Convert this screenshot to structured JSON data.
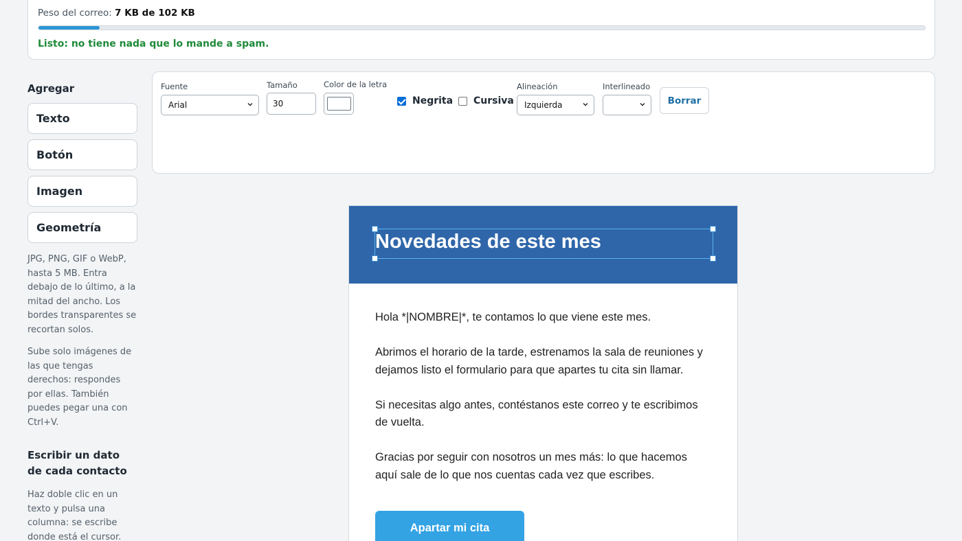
{
  "weight": {
    "label": "Peso del correo:",
    "value": "7 KB de 102 KB",
    "used_kb": 7,
    "total_kb": 102,
    "status": "Listo: no tiene nada que lo mande a spam.",
    "status_color": "#1f8a3a",
    "bar_color": "#2b95d6"
  },
  "sidebar": {
    "heading": "Agregar",
    "buttons": [
      "Texto",
      "Botón",
      "Imagen",
      "Geometría"
    ],
    "note_image": "JPG, PNG, GIF o WebP, hasta 5 MB. Entra debajo de lo último, a la mitad del ancho. Los bordes transparentes se recortan solos.",
    "note_rights": "Sube solo imágenes de las que tengas derechos: respondes por ellas. También puedes pegar una con Ctrl+V.",
    "heading_contact": "Escribir un dato de cada contacto",
    "note_contact": "Haz doble clic en un texto y pulsa una columna: se escribe donde está el cursor."
  },
  "toolbar": {
    "font_label": "Fuente",
    "font_value": "Arial",
    "size_label": "Tamaño",
    "size_value": "30",
    "color_label": "Color de la letra",
    "color_value": "#ffffff",
    "bold_label": "Negrita",
    "bold_checked": true,
    "italic_label": "Cursiva",
    "italic_checked": false,
    "align_label": "Alineación",
    "align_value": "Izquierda",
    "lineheight_label": "Interlineado",
    "lineheight_value": "",
    "clear_label": "Borrar"
  },
  "email": {
    "header_color": "#2f66a9",
    "title": "Novedades de este mes",
    "paragraphs": [
      "Hola *|NOMBRE|*, te contamos lo que viene este mes.",
      "Abrimos el horario de la tarde, estrenamos la sala de reuniones y dejamos listo el formulario para que apartes tu cita sin llamar.",
      "Si necesitas algo antes, contéstanos este correo y te escribimos de vuelta.",
      "Gracias por seguir con nosotros un mes más: lo que hacemos aquí sale de lo que nos cuentas cada vez que escribes."
    ],
    "cta_label": "Apartar mi cita",
    "cta_color": "#34a3e4"
  }
}
